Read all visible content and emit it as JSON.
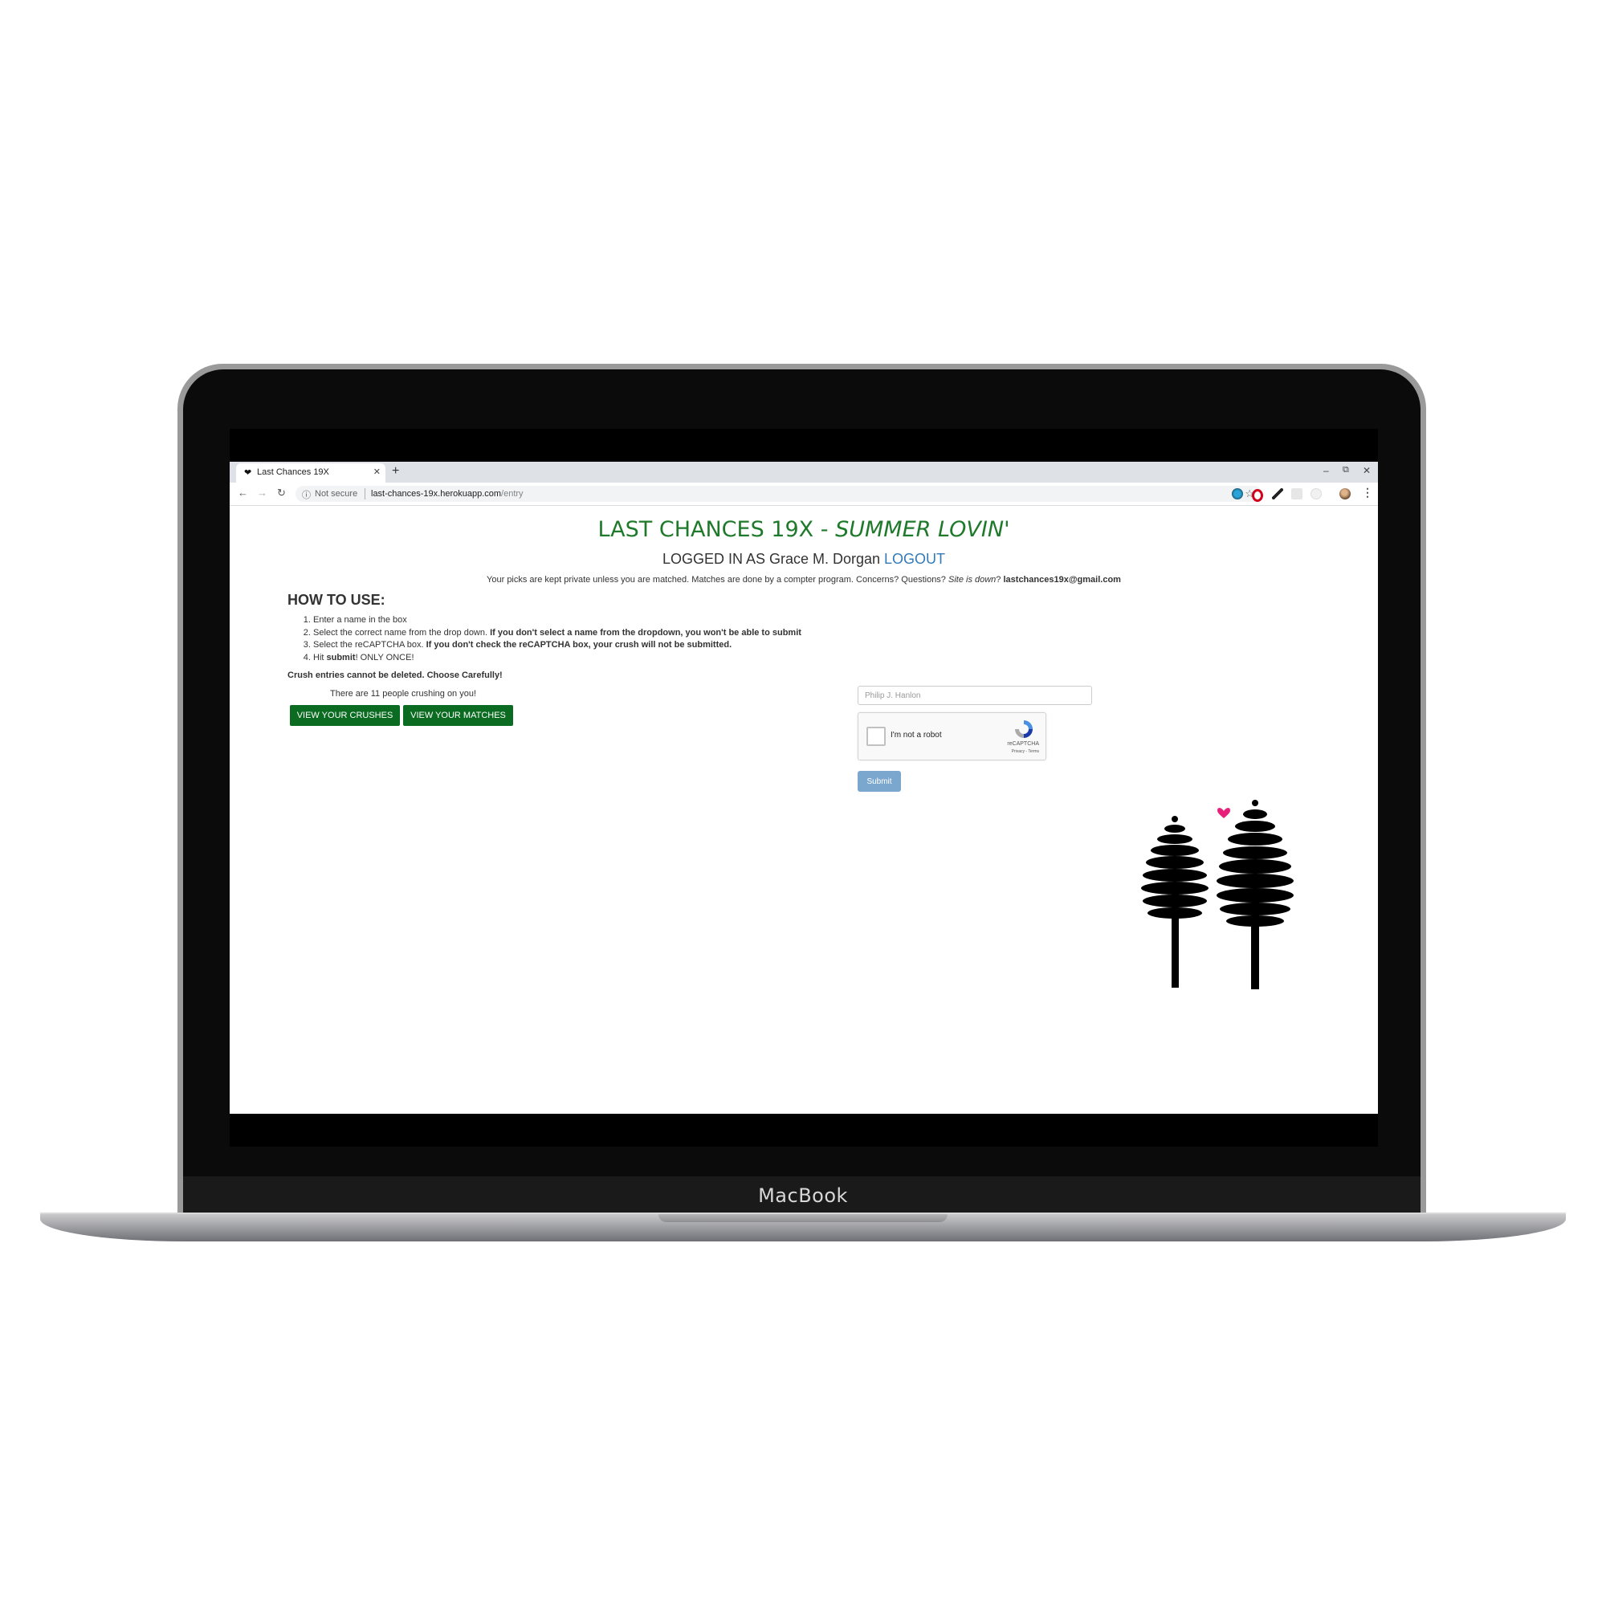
{
  "device": {
    "brand_label": "MacBook"
  },
  "browser": {
    "tab_title": "Last Chances 19X",
    "tab_favicon": "heart-icon",
    "new_tab_symbol": "+",
    "window_controls": {
      "minimize": "–",
      "restore": "⧉",
      "close": "✕"
    },
    "security_label": "Not secure",
    "url_host": "last-chances-19x.herokuapp.com",
    "url_path": "/entry"
  },
  "page": {
    "title_main": "LAST CHANCES 19X - ",
    "title_italic": "SUMMER LOVIN'",
    "logged_in_prefix": "LOGGED IN AS Grace M. Dorgan",
    "logout_label": "LOGOUT",
    "privacy_text": "Your picks are kept private unless you are matched. Matches are done by a compter program. Concerns? Questions? ",
    "privacy_italic": "Site is down",
    "privacy_q": "? ",
    "contact_email": "lastchances19x@gmail.com",
    "how_to_title": "HOW TO USE:",
    "steps": [
      {
        "text": "Enter a name in the box",
        "bold": ""
      },
      {
        "text": "Select the correct name from the drop down. ",
        "bold": "If you don't select a name from the dropdown, you won't be able to submit"
      },
      {
        "text": "Select the reCAPTCHA box. ",
        "bold": "If you don't check the reCAPTCHA box, your crush will not be submitted."
      },
      {
        "text": "Hit ",
        "bold": "submit",
        "after": "! ONLY ONCE!"
      }
    ],
    "warning": "Crush entries cannot be deleted. Choose Carefully!",
    "crush_count_text": "There are 11 people crushing on you!",
    "view_crushes_label": "VIEW YOUR CRUSHES",
    "view_matches_label": "VIEW YOUR MATCHES",
    "name_input_placeholder": "Philip J. Hanlon",
    "recaptcha_label": "I'm not a robot",
    "recaptcha_brand": "reCAPTCHA",
    "recaptcha_terms": "Privacy - Terms",
    "submit_label": "Submit"
  },
  "colors": {
    "title_green": "#1e7a2a",
    "button_green": "#0b6b21",
    "link_blue": "#337ab7",
    "submit_blue": "#7ba7cf",
    "heart_pink": "#e8207a"
  }
}
